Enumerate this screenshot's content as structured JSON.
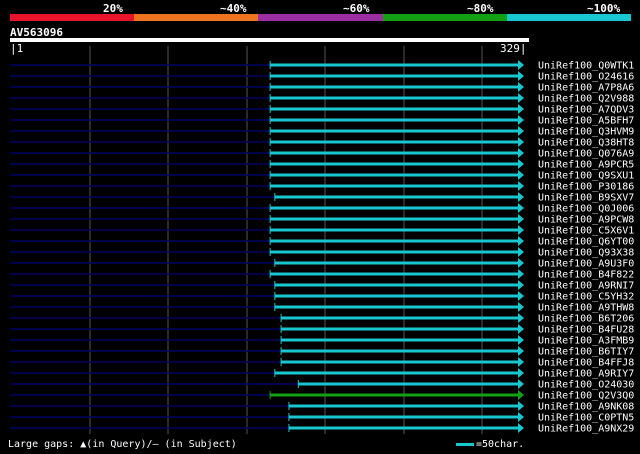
{
  "legend": {
    "labels": [
      "20%",
      "~40%",
      "~60%",
      "~80%",
      "~100%"
    ],
    "colors": [
      "#e8142c",
      "#ee7420",
      "#9b2ea0",
      "#14a014",
      "#19c7d0"
    ]
  },
  "query": {
    "id": "AV563096",
    "start": "1",
    "end": "329",
    "length": 329
  },
  "colors": {
    "hit": "#19c7d0",
    "hit_alt": "#14a014",
    "gap": "#000064",
    "grid": "#555555",
    "background": "#000000"
  },
  "hits": [
    {
      "id": "UniRef100_Q0WTK1",
      "start": 167,
      "end": 329,
      "color": "hit"
    },
    {
      "id": "UniRef100_O24616",
      "start": 167,
      "end": 329,
      "color": "hit"
    },
    {
      "id": "UniRef100_A7P8A6",
      "start": 167,
      "end": 329,
      "color": "hit"
    },
    {
      "id": "UniRef100_Q2V988",
      "start": 167,
      "end": 329,
      "color": "hit"
    },
    {
      "id": "UniRef100_A7QDV3",
      "start": 167,
      "end": 329,
      "color": "hit"
    },
    {
      "id": "UniRef100_A5BFH7",
      "start": 167,
      "end": 329,
      "color": "hit"
    },
    {
      "id": "UniRef100_Q3HVM9",
      "start": 167,
      "end": 329,
      "color": "hit"
    },
    {
      "id": "UniRef100_Q38HT8",
      "start": 167,
      "end": 329,
      "color": "hit"
    },
    {
      "id": "UniRef100_Q076A9",
      "start": 167,
      "end": 329,
      "color": "hit"
    },
    {
      "id": "UniRef100_A9PCR5",
      "start": 167,
      "end": 329,
      "color": "hit"
    },
    {
      "id": "UniRef100_Q9SXU1",
      "start": 167,
      "end": 329,
      "color": "hit"
    },
    {
      "id": "UniRef100_P30186",
      "start": 167,
      "end": 329,
      "color": "hit"
    },
    {
      "id": "UniRef100_B9SXV7",
      "start": 170,
      "end": 329,
      "color": "hit"
    },
    {
      "id": "UniRef100_Q0J006",
      "start": 167,
      "end": 329,
      "color": "hit"
    },
    {
      "id": "UniRef100_A9PCW8",
      "start": 167,
      "end": 329,
      "color": "hit"
    },
    {
      "id": "UniRef100_C5X6V1",
      "start": 167,
      "end": 329,
      "color": "hit"
    },
    {
      "id": "UniRef100_Q6YT00",
      "start": 167,
      "end": 329,
      "color": "hit"
    },
    {
      "id": "UniRef100_Q93X38",
      "start": 167,
      "end": 329,
      "color": "hit"
    },
    {
      "id": "UniRef100_A9U3F0",
      "start": 170,
      "end": 329,
      "color": "hit"
    },
    {
      "id": "UniRef100_B4F822",
      "start": 167,
      "end": 329,
      "color": "hit"
    },
    {
      "id": "UniRef100_A9RNI7",
      "start": 170,
      "end": 329,
      "color": "hit"
    },
    {
      "id": "UniRef100_C5YH32",
      "start": 170,
      "end": 329,
      "color": "hit"
    },
    {
      "id": "UniRef100_A9THW8",
      "start": 170,
      "end": 329,
      "color": "hit"
    },
    {
      "id": "UniRef100_B6T206",
      "start": 174,
      "end": 329,
      "color": "hit"
    },
    {
      "id": "UniRef100_B4FU28",
      "start": 174,
      "end": 329,
      "color": "hit"
    },
    {
      "id": "UniRef100_A3FMB9",
      "start": 174,
      "end": 329,
      "color": "hit"
    },
    {
      "id": "UniRef100_B6TIY7",
      "start": 174,
      "end": 329,
      "color": "hit"
    },
    {
      "id": "UniRef100_B4FFJ8",
      "start": 174,
      "end": 329,
      "color": "hit"
    },
    {
      "id": "UniRef100_A9RIY7",
      "start": 170,
      "end": 329,
      "color": "hit"
    },
    {
      "id": "UniRef100_O24030",
      "start": 185,
      "end": 329,
      "color": "hit"
    },
    {
      "id": "UniRef100_Q2V3Q0",
      "start": 167,
      "end": 329,
      "color": "hit_alt"
    },
    {
      "id": "UniRef100_A9NK08",
      "start": 179,
      "end": 329,
      "color": "hit"
    },
    {
      "id": "UniRef100_C0PTN5",
      "start": 179,
      "end": 329,
      "color": "hit"
    },
    {
      "id": "UniRef100_A9NX29",
      "start": 179,
      "end": 329,
      "color": "hit"
    }
  ],
  "footer": {
    "gaps_label": "Large gaps:",
    "gaps_query": "▲(in Query)/",
    "gaps_subject": "— (in Subject)",
    "scale_label": "=50char."
  }
}
